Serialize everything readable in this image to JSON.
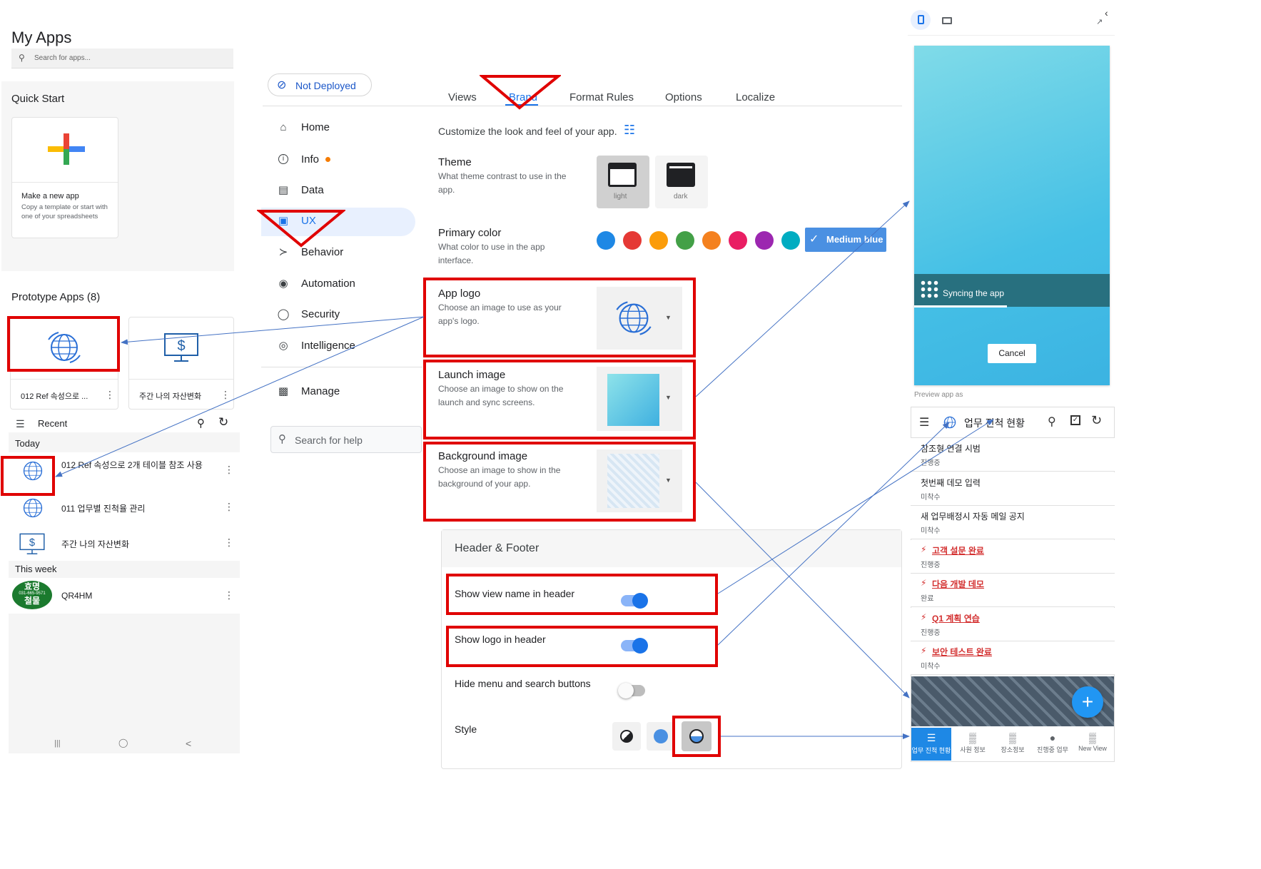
{
  "left": {
    "title": "My Apps",
    "search_placeholder": "Search for apps...",
    "quick_start": "Quick Start",
    "new_app_title": "Make a new app",
    "new_app_desc": "Copy a template or start with one of your spreadsheets",
    "prototype_apps": "Prototype Apps (8)",
    "proto_cards": [
      {
        "name": "012 Ref 속성으로 ..."
      },
      {
        "name": "주간 나의 자산변화"
      }
    ],
    "recent_label": "Recent",
    "today_label": "Today",
    "this_week_label": "This week",
    "recent_items": [
      {
        "name": "012 Ref 속성으로 2개 테이블 참조 사용"
      },
      {
        "name": "011 업무별 진척율 관리"
      },
      {
        "name": "주간 나의 자산변화"
      }
    ],
    "week_items": [
      {
        "name": "QR4HM",
        "logo_top": "효명",
        "logo_phone": "031-665-9571",
        "logo_bottom": "철물"
      }
    ],
    "android_nav": [
      "|||",
      "◯",
      "<"
    ]
  },
  "middle": {
    "deploy_status": "Not Deployed",
    "tabs": [
      "Views",
      "Brand",
      "Format Rules",
      "Options",
      "Localize"
    ],
    "active_tab": "Brand",
    "nav": [
      {
        "label": "Home",
        "icon": "home-icon"
      },
      {
        "label": "Info",
        "icon": "info-icon"
      },
      {
        "label": "Data",
        "icon": "data-icon"
      },
      {
        "label": "UX",
        "icon": "ux-icon"
      },
      {
        "label": "Behavior",
        "icon": "behavior-icon"
      },
      {
        "label": "Automation",
        "icon": "automation-icon"
      },
      {
        "label": "Security",
        "icon": "security-icon"
      },
      {
        "label": "Intelligence",
        "icon": "intelligence-icon"
      },
      {
        "label": "Manage",
        "icon": "manage-icon"
      }
    ],
    "help_placeholder": "Search for help",
    "intro": "Customize the look and feel of your app.",
    "theme": {
      "title": "Theme",
      "desc": "What theme contrast to use in the app.",
      "light": "light",
      "dark": "dark"
    },
    "primary_color": {
      "title": "Primary color",
      "desc": "What color to use in the app interface.",
      "selected": "Medium blue",
      "swatches": [
        "#1e88e5",
        "#e53935",
        "#fb9c0a",
        "#43a047",
        "#f4811f",
        "#e91e63",
        "#9c27b0",
        "#00acc1"
      ]
    },
    "app_logo": {
      "title": "App logo",
      "desc": "Choose an image to use as your app's logo."
    },
    "launch_image": {
      "title": "Launch image",
      "desc": "Choose an image to show on the launch and sync screens."
    },
    "background_image": {
      "title": "Background image",
      "desc": "Choose an image to show in the background of your app."
    },
    "header_footer": {
      "title": "Header & Footer",
      "show_view_name": "Show view name in header",
      "show_logo": "Show logo in header",
      "hide_menu": "Hide menu and search buttons",
      "style": "Style"
    }
  },
  "preview": {
    "syncing": "Syncing the app",
    "cancel": "Cancel",
    "preview_as": "Preview app as",
    "header_title": "업무 진척 현황",
    "items": [
      {
        "title": "참조형 연결 시범",
        "status": "진행중",
        "flag": false
      },
      {
        "title": "첫번째 데모 입력",
        "status": "미착수",
        "flag": false
      },
      {
        "title": "새 업무배정시 자동 메일 공지",
        "status": "미착수",
        "flag": false
      },
      {
        "title": "고객 설문 완료",
        "status": "진행중",
        "flag": true
      },
      {
        "title": "다음 개발 데모",
        "status": "완료",
        "flag": true
      },
      {
        "title": "Q1 계획 연습",
        "status": "진행중",
        "flag": true
      },
      {
        "title": "보안 테스트 완료",
        "status": "미착수",
        "flag": true
      }
    ],
    "bottom_nav": [
      "업무 진척 현황",
      "사원 정보",
      "장소정보",
      "진행중 업무",
      "New View"
    ]
  },
  "colors": {
    "accent": "#1a73e8",
    "red_highlight": "#e00000",
    "launch_teal": "#3fc4e4"
  }
}
